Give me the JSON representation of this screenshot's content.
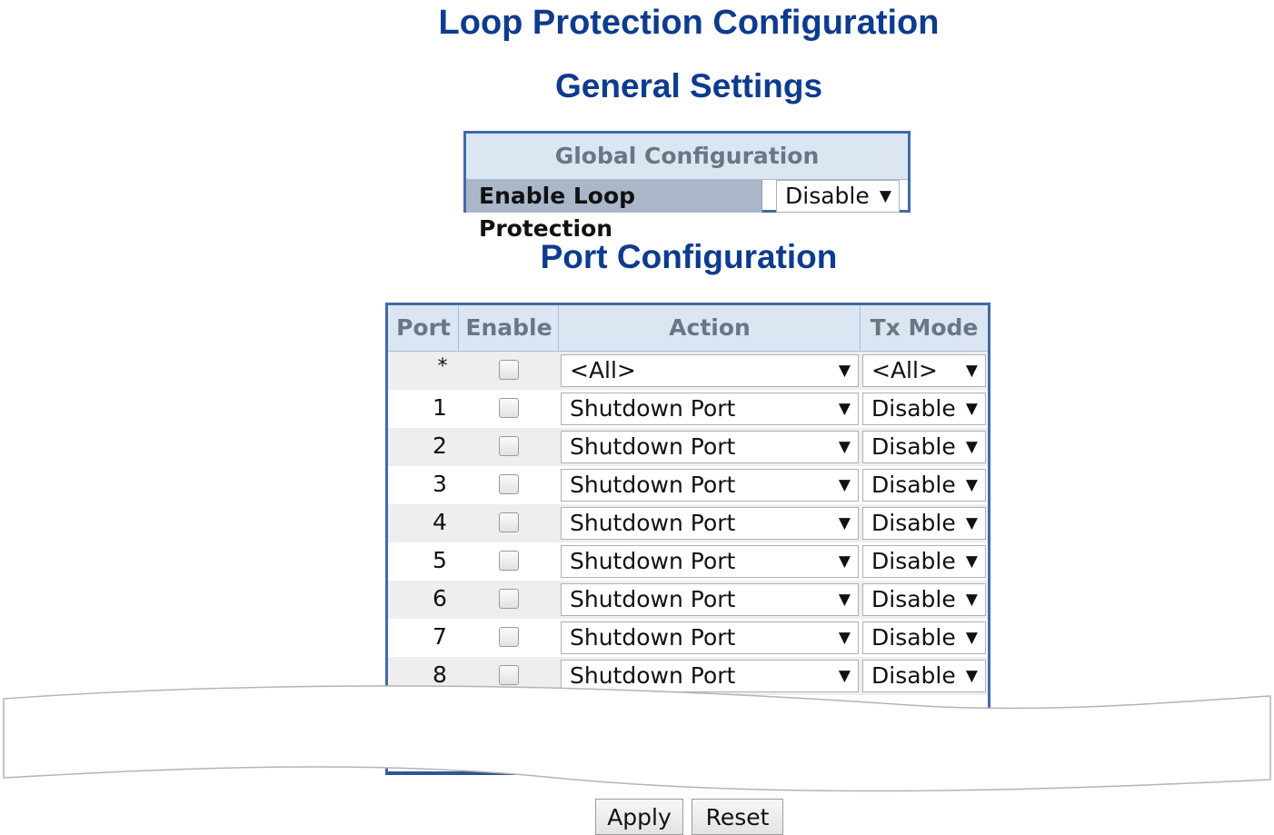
{
  "page_title": "Loop Protection Configuration",
  "general_settings_title": "General Settings",
  "global_config": {
    "header": "Global Configuration",
    "enable_label": "Enable Loop Protection",
    "enable_value": "Disable"
  },
  "port_config_title": "Port Configuration",
  "port_table": {
    "columns": [
      "Port",
      "Enable",
      "Action",
      "Tx Mode"
    ],
    "rows": [
      {
        "port": "*",
        "enabled": false,
        "action": "<All>",
        "tx_mode": "<All>"
      },
      {
        "port": "1",
        "enabled": false,
        "action": "Shutdown Port",
        "tx_mode": "Disable"
      },
      {
        "port": "2",
        "enabled": false,
        "action": "Shutdown Port",
        "tx_mode": "Disable"
      },
      {
        "port": "3",
        "enabled": false,
        "action": "Shutdown Port",
        "tx_mode": "Disable"
      },
      {
        "port": "4",
        "enabled": false,
        "action": "Shutdown Port",
        "tx_mode": "Disable"
      },
      {
        "port": "5",
        "enabled": false,
        "action": "Shutdown Port",
        "tx_mode": "Disable"
      },
      {
        "port": "6",
        "enabled": false,
        "action": "Shutdown Port",
        "tx_mode": "Disable"
      },
      {
        "port": "7",
        "enabled": false,
        "action": "Shutdown Port",
        "tx_mode": "Disable"
      },
      {
        "port": "8",
        "enabled": false,
        "action": "Shutdown Port",
        "tx_mode": "Disable"
      }
    ]
  },
  "buttons": {
    "apply": "Apply",
    "reset": "Reset"
  },
  "icons": {
    "dropdown": "dropdown-arrow-icon"
  },
  "colors": {
    "title": "#0d3b8e",
    "table_border": "#3f6aa8",
    "header_bg": "#dce6f3",
    "label_bg": "#aab7c9",
    "alt_row_bg": "#eeeeee"
  }
}
